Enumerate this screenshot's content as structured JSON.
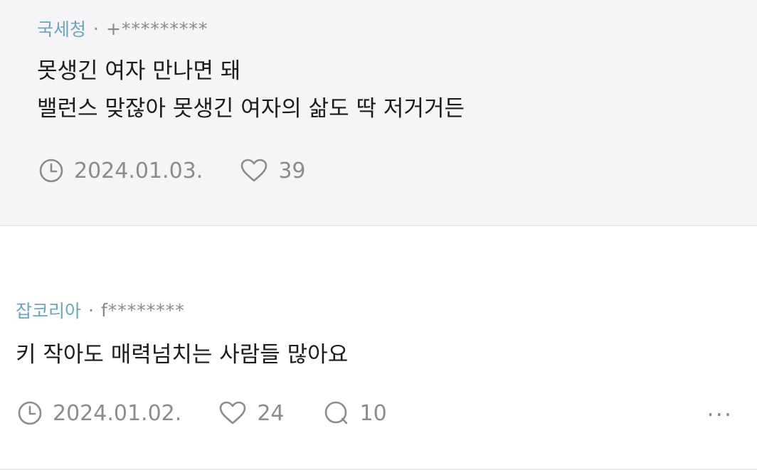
{
  "comments": [
    {
      "company": "국세청",
      "separator": "·",
      "user": "+*********",
      "lines": [
        "못생긴 여자 만나면 돼",
        "밸런스 맞잖아 못생긴 여자의 삶도 딱 저거거든"
      ],
      "date": "2024.01.03.",
      "likes": "39",
      "icons": {
        "time": "clock-icon",
        "like": "heart-icon"
      }
    },
    {
      "company": "잡코리아",
      "separator": "·",
      "user": "f********",
      "lines": [
        "키 작아도 매력넘치는 사람들 많아요"
      ],
      "date": "2024.01.02.",
      "likes": "24",
      "replies": "10",
      "more": "···",
      "icons": {
        "time": "clock-icon",
        "like": "heart-icon",
        "reply": "comment-bubble-icon",
        "more": "more-dots-icon"
      }
    }
  ],
  "colors": {
    "company": "#6aa6bf",
    "muted": "#8c8c8c",
    "reply_background": "#f5f5f7",
    "text": "#1c1c1c"
  }
}
